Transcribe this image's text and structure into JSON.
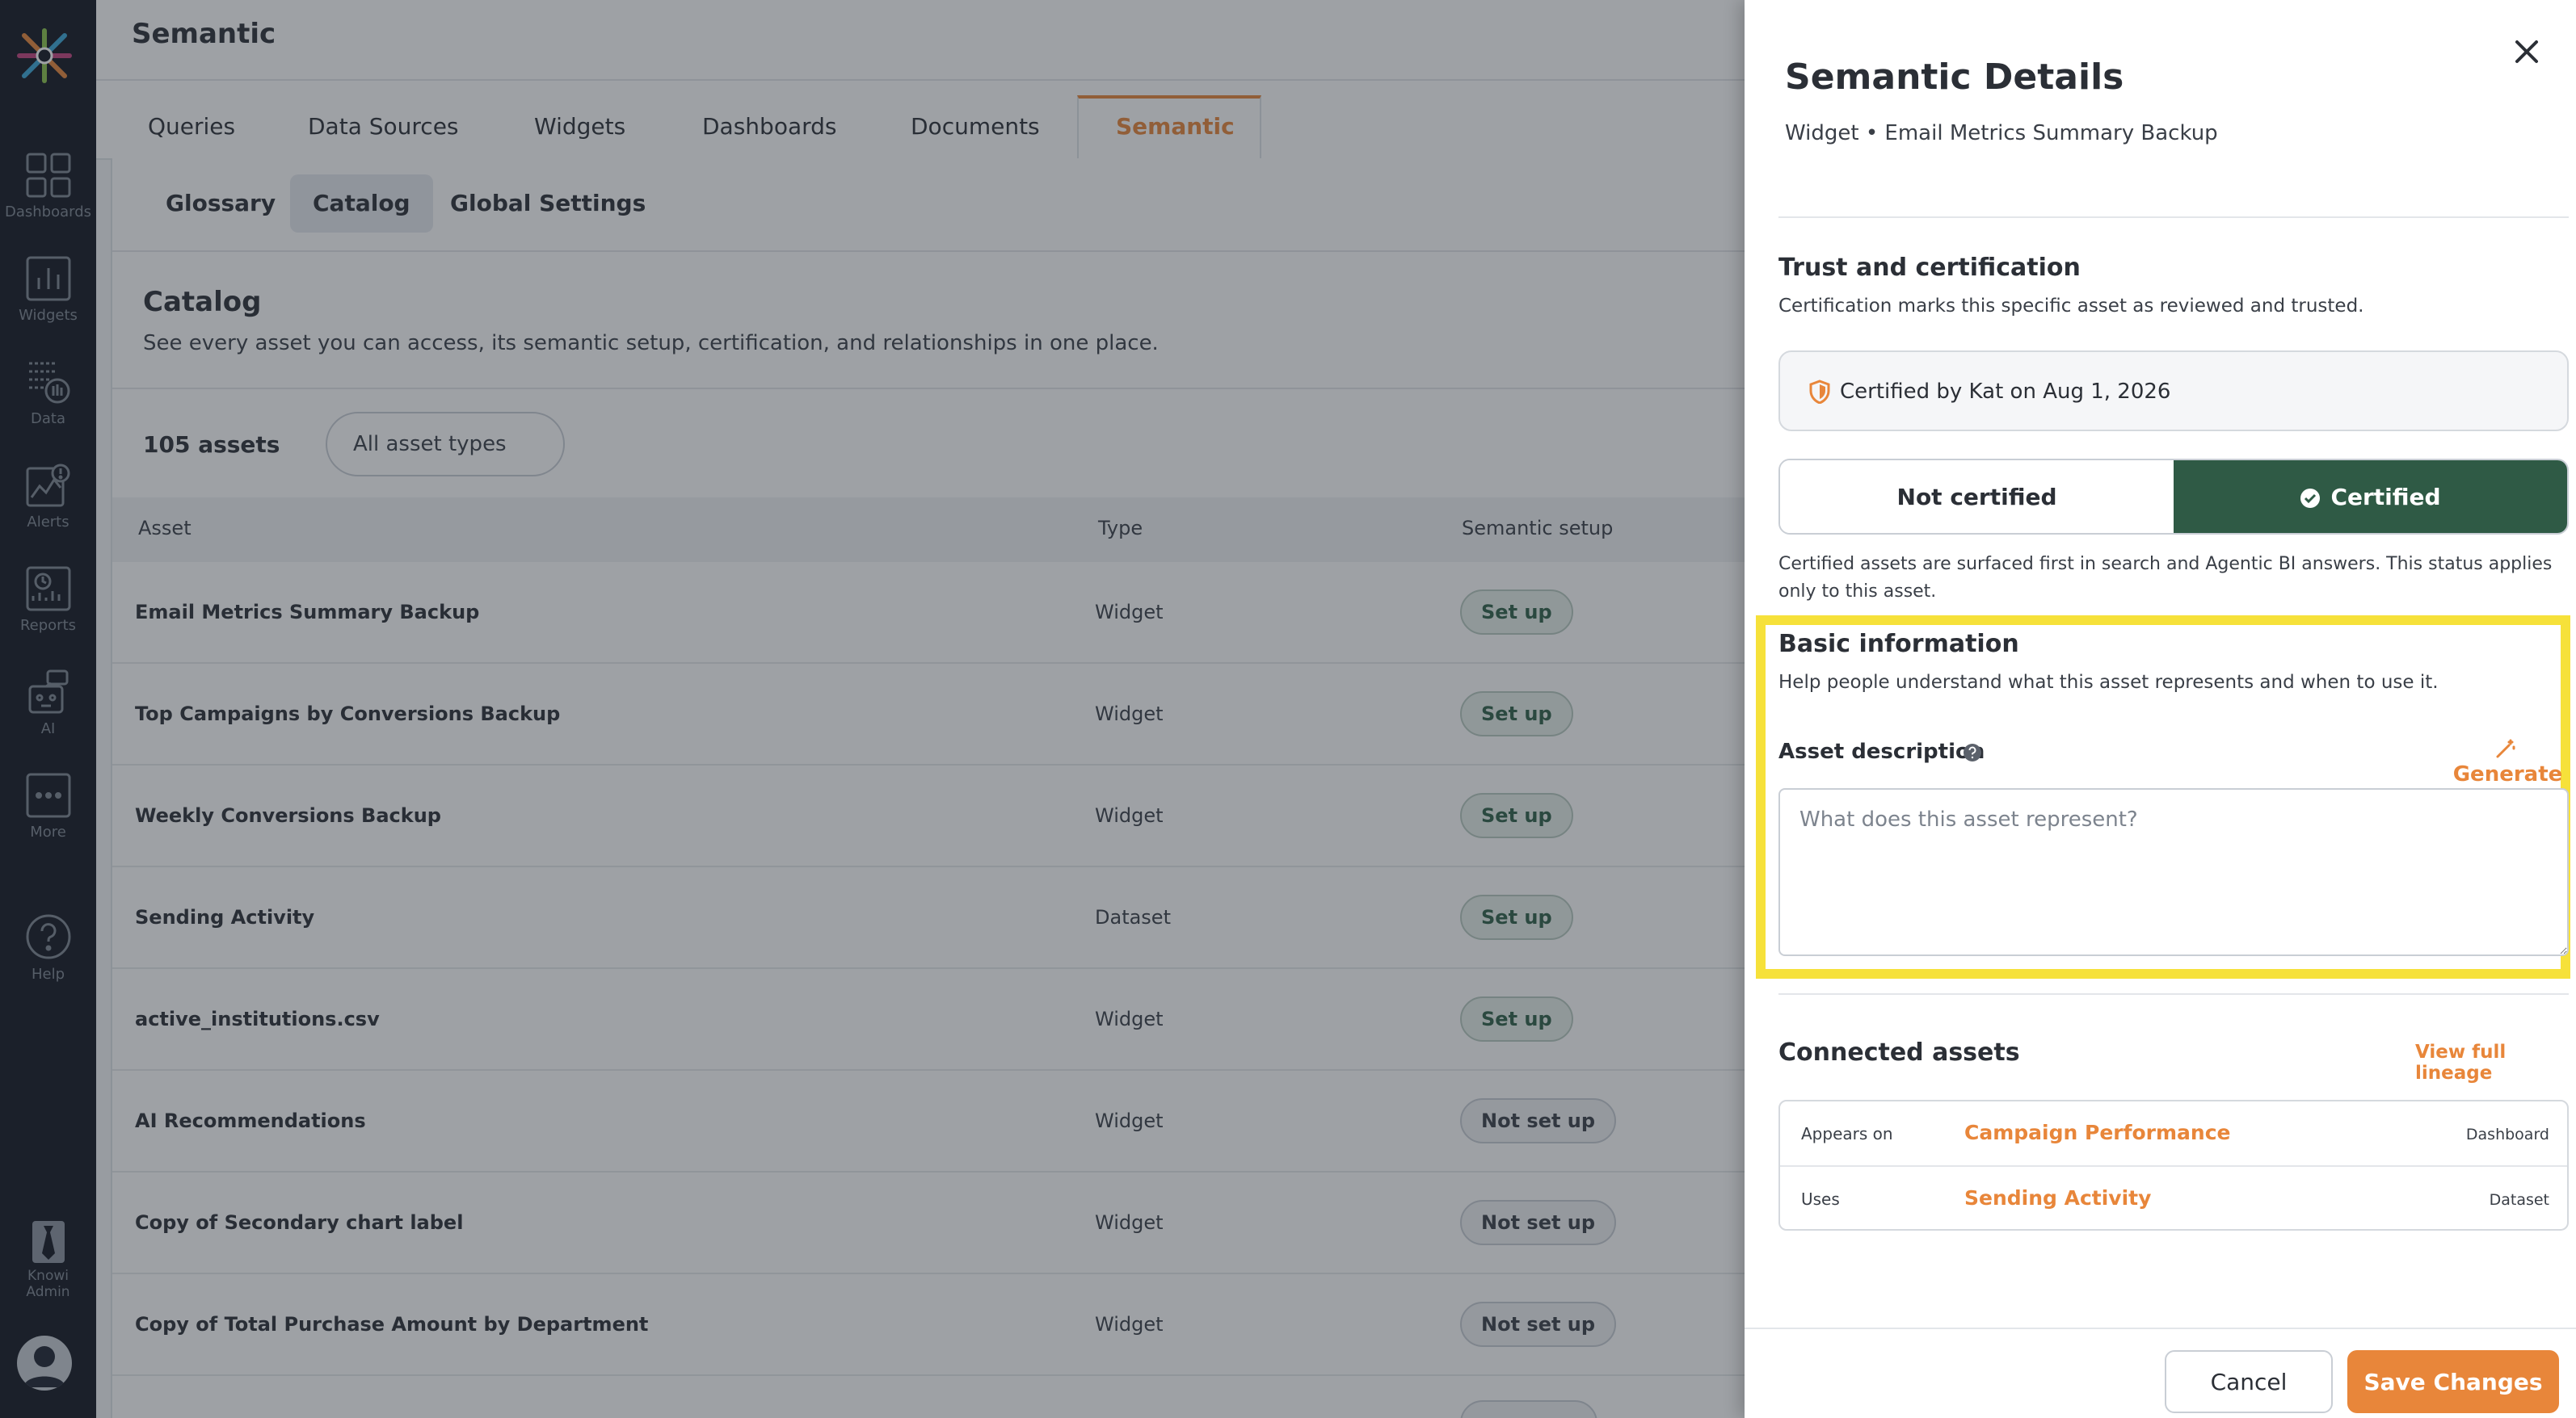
{
  "sidebar": {
    "items": [
      {
        "label": "Dashboards",
        "icon": "grid-icon"
      },
      {
        "label": "Widgets",
        "icon": "bar-chart-icon"
      },
      {
        "label": "Data",
        "icon": "database-icon"
      },
      {
        "label": "Alerts",
        "icon": "alert-icon"
      },
      {
        "label": "Reports",
        "icon": "report-icon"
      },
      {
        "label": "AI",
        "icon": "robot-icon"
      },
      {
        "label": "More",
        "icon": "more-icon"
      },
      {
        "label": "Help",
        "icon": "help-icon"
      }
    ],
    "admin_label": "Knowi Admin",
    "admin_line1": "Knowi",
    "admin_line2": "Admin"
  },
  "header": {
    "title": "Semantic"
  },
  "tabs": [
    {
      "label": "Queries"
    },
    {
      "label": "Data Sources"
    },
    {
      "label": "Widgets"
    },
    {
      "label": "Dashboards"
    },
    {
      "label": "Documents"
    },
    {
      "label": "Semantic"
    }
  ],
  "subtabs": [
    {
      "label": "Glossary"
    },
    {
      "label": "Catalog"
    },
    {
      "label": "Global Settings"
    }
  ],
  "catalog": {
    "title": "Catalog",
    "description": "See every asset you can access, its semantic setup, certification, and relationships in one place.",
    "count": "105 assets",
    "filter_label": "All asset types",
    "columns": {
      "asset": "Asset",
      "type": "Type",
      "semantic_setup": "Semantic setup"
    },
    "rows": [
      {
        "asset": "Email Metrics Summary Backup",
        "type": "Widget",
        "status": "Set up"
      },
      {
        "asset": "Top Campaigns by Conversions Backup",
        "type": "Widget",
        "status": "Set up"
      },
      {
        "asset": "Weekly Conversions Backup",
        "type": "Widget",
        "status": "Set up"
      },
      {
        "asset": "Sending Activity",
        "type": "Dataset",
        "status": "Set up"
      },
      {
        "asset": "active_institutions.csv",
        "type": "Widget",
        "status": "Set up"
      },
      {
        "asset": "AI Recommendations",
        "type": "Widget",
        "status": "Not set up"
      },
      {
        "asset": "Copy of Secondary chart label",
        "type": "Widget",
        "status": "Not set up"
      },
      {
        "asset": "Copy of Total Purchase Amount by Department",
        "type": "Widget",
        "status": "Not set up"
      }
    ]
  },
  "drawer": {
    "title": "Semantic Details",
    "subtitle": "Widget • Email Metrics Summary Backup",
    "trust": {
      "heading": "Trust and certification",
      "description": "Certification marks this specific asset as reviewed and trusted.",
      "certified_by": "Certified by Kat on Aug 1, 2026",
      "not_certified_label": "Not certified",
      "certified_label": "Certified",
      "note": "Certified assets are surfaced first in search and Agentic BI answers. This status applies only to this asset."
    },
    "basic": {
      "heading": "Basic information",
      "description": "Help people understand what this asset represents and when to use it.",
      "field_label": "Asset description",
      "generate_label": "Generate",
      "placeholder": "What does this asset represent?",
      "value": ""
    },
    "connected": {
      "heading": "Connected assets",
      "view_lineage": "View full lineage",
      "rows": [
        {
          "relation": "Appears on",
          "name": "Campaign Performance",
          "type": "Dashboard"
        },
        {
          "relation": "Uses",
          "name": "Sending Activity",
          "type": "Dataset"
        }
      ]
    },
    "footer": {
      "cancel": "Cancel",
      "save": "Save Changes"
    }
  },
  "colors": {
    "accent": "#e8863a",
    "certified_green": "#2f5a45",
    "sidebar_bg": "#111520",
    "highlight": "#f6e13a"
  }
}
